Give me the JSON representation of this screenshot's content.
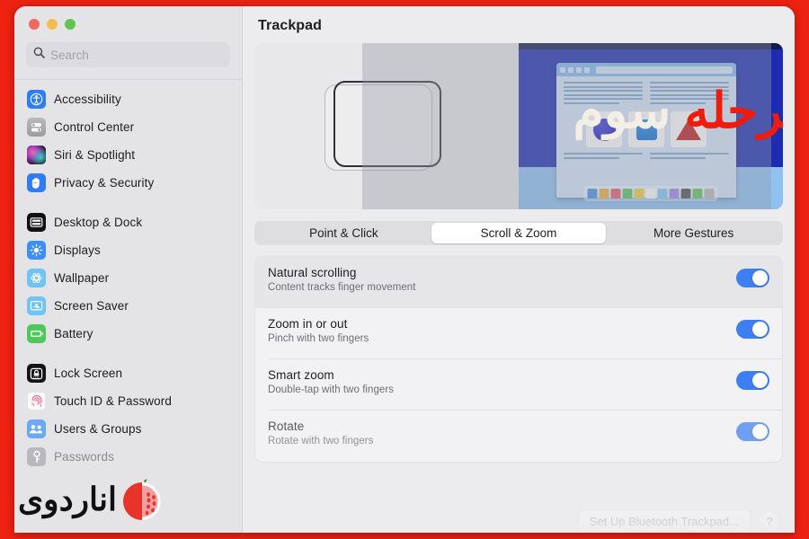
{
  "window": {
    "traffic_lights": [
      {
        "name": "close",
        "color": "#ec6a5f"
      },
      {
        "name": "minimize",
        "color": "#f4bd4f"
      },
      {
        "name": "maximize",
        "color": "#61c554"
      }
    ]
  },
  "search": {
    "placeholder": "Search",
    "value": "",
    "icon": "search-icon"
  },
  "sidebar": {
    "groups": [
      {
        "items": [
          {
            "label": "Accessibility",
            "icon": "accessibility-icon"
          },
          {
            "label": "Control Center",
            "icon": "control-center-icon"
          },
          {
            "label": "Siri & Spotlight",
            "icon": "siri-icon"
          },
          {
            "label": "Privacy & Security",
            "icon": "privacy-hand-icon"
          }
        ]
      },
      {
        "items": [
          {
            "label": "Desktop & Dock",
            "icon": "desktop-dock-icon"
          },
          {
            "label": "Displays",
            "icon": "displays-icon"
          },
          {
            "label": "Wallpaper",
            "icon": "wallpaper-icon"
          },
          {
            "label": "Screen Saver",
            "icon": "screen-saver-icon"
          },
          {
            "label": "Battery",
            "icon": "battery-icon"
          }
        ]
      },
      {
        "items": [
          {
            "label": "Lock Screen",
            "icon": "lock-screen-icon"
          },
          {
            "label": "Touch ID & Password",
            "icon": "touch-id-icon"
          },
          {
            "label": "Users & Groups",
            "icon": "users-groups-icon"
          },
          {
            "label": "Passwords",
            "icon": "passwords-key-icon"
          }
        ]
      }
    ]
  },
  "main": {
    "title": "Trackpad",
    "tabs": [
      {
        "label": "Point & Click",
        "active": false
      },
      {
        "label": "Scroll & Zoom",
        "active": true
      },
      {
        "label": "More Gestures",
        "active": false
      }
    ],
    "settings": [
      {
        "title": "Natural scrolling",
        "subtitle": "Content tracks finger movement",
        "toggle": "on",
        "highlighted": true
      },
      {
        "title": "Zoom in or out",
        "subtitle": "Pinch with two fingers",
        "toggle": "on",
        "highlighted": false
      },
      {
        "title": "Smart zoom",
        "subtitle": "Double-tap with two fingers",
        "toggle": "on",
        "highlighted": false
      },
      {
        "title": "Rotate",
        "subtitle": "Rotate with two fingers",
        "toggle": "on",
        "highlighted": false
      }
    ],
    "bottom_buttons": {
      "setup_label": "Set Up Bluetooth Trackpad...",
      "help_label": "?"
    },
    "preview": {
      "swatch_colors": [
        "#4a90e8",
        "#f2ae3c",
        "#e8596b",
        "#5cc45c",
        "#f2cf3c",
        "#fdfdfd",
        "#7fc9f0",
        "#9d86e8",
        "#4d4d4f",
        "#5cc45c",
        "#b7b7ba"
      ],
      "shapes": [
        "circle",
        "square",
        "triangle"
      ],
      "accent_desktop": "#1b2cb0"
    }
  },
  "overlay": {
    "text_white": "سوم",
    "text_red": "مرحله",
    "color_white": "#f3efe6",
    "color_red": "#ef1b0b"
  },
  "watermark": {
    "text": "اناردوی",
    "logo": "pomegranate-icon",
    "color": "#e8332a"
  },
  "frame": {
    "border_color": "#ee2211"
  }
}
